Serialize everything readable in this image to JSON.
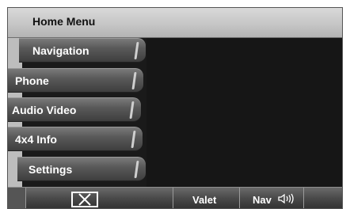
{
  "header": {
    "title": "Home Menu"
  },
  "menu": {
    "items": [
      {
        "label": "Navigation"
      },
      {
        "label": "Phone"
      },
      {
        "label": "Audio Video"
      },
      {
        "label": "4x4 Info"
      },
      {
        "label": "Settings"
      }
    ]
  },
  "bottom": {
    "close_icon": "close-x-icon",
    "valet_label": "Valet",
    "nav_label": "Nav",
    "speaker_icon": "speaker-volume-icon"
  }
}
